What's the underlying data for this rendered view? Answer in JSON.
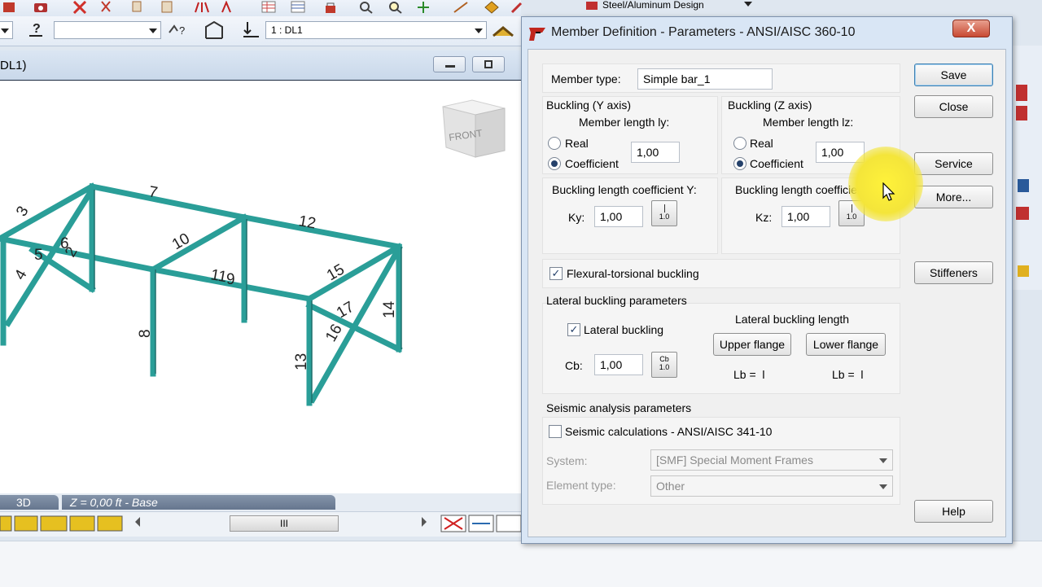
{
  "toolbar": {
    "design_combo": "Steel/Aluminum Design",
    "load_case_combo": "1 : DL1"
  },
  "view": {
    "title": "DL1)",
    "tabs": [
      "3D",
      "Z = 0,00 ft - Base"
    ],
    "scroll_thumb": "III",
    "cube_faces": [
      "FRONT"
    ],
    "member_labels": [
      "3",
      "7",
      "12",
      "6",
      "2",
      "5",
      "10",
      "4",
      "11",
      "9",
      "15",
      "8",
      "14",
      "17",
      "16",
      "13"
    ]
  },
  "dialog": {
    "title": "Member Definition - Parameters - ANSI/AISC 360-10",
    "close_glyph": "X",
    "member_type_label": "Member type:",
    "member_type_value": "Simple bar_1",
    "buckling_y": {
      "title": "Buckling (Y axis)",
      "length_label": "Member length ly:",
      "real_label": "Real",
      "coefficient_label": "Coefficient",
      "value": "1,00",
      "coef_title": "Buckling length coefficient Y:",
      "k_label": "Ky:",
      "k_value": "1,00",
      "btn_text": "1.0"
    },
    "buckling_z": {
      "title": "Buckling (Z axis)",
      "length_label": "Member length lz:",
      "real_label": "Real",
      "coefficient_label": "Coefficient",
      "value": "1,00",
      "coef_title": "Buckling length coefficient Z:",
      "k_label": "Kz:",
      "k_value": "1,00",
      "btn_text": "1.0"
    },
    "flexural_torsional_label": "Flexural-torsional buckling",
    "lateral": {
      "title": "Lateral buckling parameters",
      "checkbox_label": "Lateral buckling",
      "length_title": "Lateral buckling length",
      "cb_label": "Cb:",
      "cb_value": "1,00",
      "cb_btn_top": "Cb",
      "cb_btn_bottom": "1.0",
      "upper_flange": "Upper flange",
      "lower_flange": "Lower flange",
      "lb_upper": "Lb =  l",
      "lb_lower": "Lb =  l"
    },
    "seismic": {
      "title": "Seismic analysis parameters",
      "checkbox_label": "Seismic calculations - ANSI/AISC  341-10",
      "system_label": "System:",
      "system_value": "[SMF] Special Moment Frames",
      "element_label": "Element type:",
      "element_value": "Other"
    },
    "buttons": {
      "save": "Save",
      "close": "Close",
      "service": "Service",
      "more": "More...",
      "stiffeners": "Stiffeners",
      "help": "Help"
    }
  },
  "colors": {
    "frame": "#2a9e98",
    "frame_dark": "#1d6e6a",
    "highlight": "#f4e53a",
    "dialog_bg": "#f0f0f0"
  }
}
